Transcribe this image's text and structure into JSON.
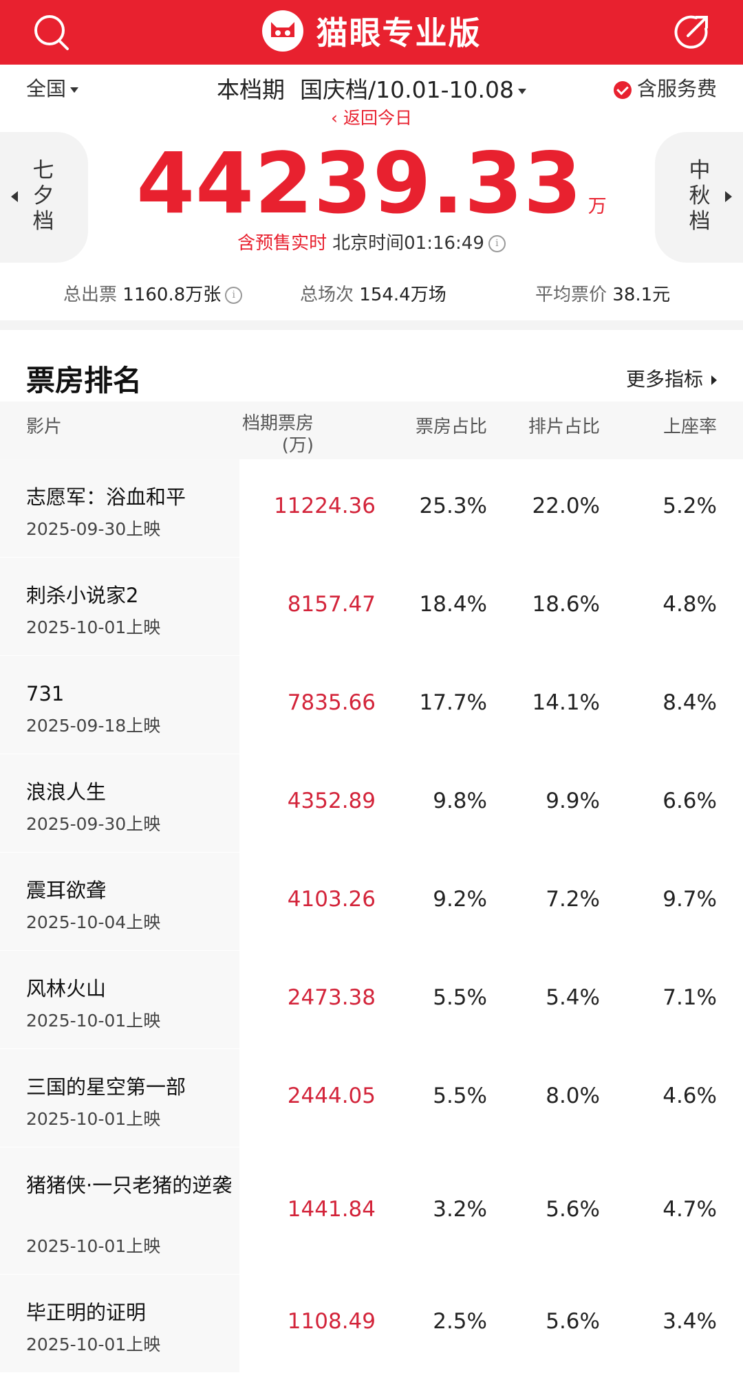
{
  "header": {
    "app_name": "猫眼专业版"
  },
  "filters": {
    "region": "全国",
    "period_label": "本档期",
    "period_value": "国庆档/10.01-10.08",
    "fee_label": "含服务费"
  },
  "back_today": "‹ 返回今日",
  "prev_period": "七夕档",
  "next_period": "中秋档",
  "total": {
    "value": "44239.33",
    "unit": "万"
  },
  "realtime": {
    "prefix": "含预售实时",
    "time": "北京时间01:16:49"
  },
  "stats": {
    "tickets_label": "总出票",
    "tickets_value": "1160.8万张",
    "shows_label": "总场次",
    "shows_value": "154.4万场",
    "price_label": "平均票价",
    "price_value": "38.1元"
  },
  "ranking": {
    "title": "票房排名",
    "more": "更多指标",
    "columns": {
      "film": "影片",
      "box_line1": "档期票房",
      "box_line2": "(万)",
      "share": "票房占比",
      "shows": "排片占比",
      "occupancy": "上座率"
    },
    "rows": [
      {
        "title": "志愿军：浴血和平",
        "date": "2025-09-30上映",
        "box": "11224.36",
        "share": "25.3%",
        "shows": "22.0%",
        "occ": "5.2%"
      },
      {
        "title": "刺杀小说家2",
        "date": "2025-10-01上映",
        "box": "8157.47",
        "share": "18.4%",
        "shows": "18.6%",
        "occ": "4.8%"
      },
      {
        "title": "731",
        "date": "2025-09-18上映",
        "box": "7835.66",
        "share": "17.7%",
        "shows": "14.1%",
        "occ": "8.4%"
      },
      {
        "title": "浪浪人生",
        "date": "2025-09-30上映",
        "box": "4352.89",
        "share": "9.8%",
        "shows": "9.9%",
        "occ": "6.6%"
      },
      {
        "title": "震耳欲聋",
        "date": "2025-10-04上映",
        "box": "4103.26",
        "share": "9.2%",
        "shows": "7.2%",
        "occ": "9.7%"
      },
      {
        "title": "风林火山",
        "date": "2025-10-01上映",
        "box": "2473.38",
        "share": "5.5%",
        "shows": "5.4%",
        "occ": "7.1%"
      },
      {
        "title": "三国的星空第一部",
        "date": "2025-10-01上映",
        "box": "2444.05",
        "share": "5.5%",
        "shows": "8.0%",
        "occ": "4.6%"
      },
      {
        "title": "猪猪侠·一只老猪的逆袭",
        "date": "2025-10-01上映",
        "box": "1441.84",
        "share": "3.2%",
        "shows": "5.6%",
        "occ": "4.7%"
      },
      {
        "title": "毕正明的证明",
        "date": "2025-10-01上映",
        "box": "1108.49",
        "share": "2.5%",
        "shows": "5.6%",
        "occ": "3.4%"
      }
    ]
  },
  "colors": {
    "brand_red": "#e8212f",
    "box_red": "#d3243a"
  }
}
